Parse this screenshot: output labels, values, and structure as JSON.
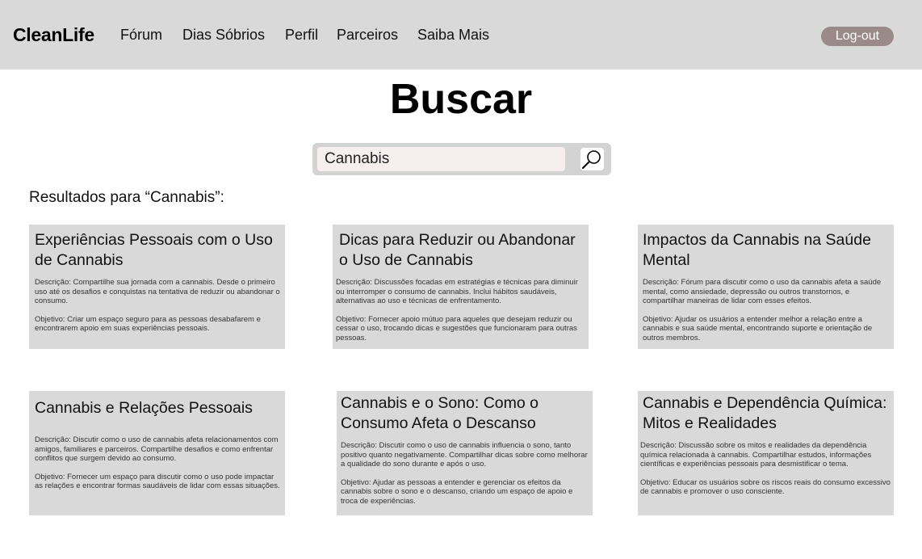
{
  "header": {
    "logo": "CleanLife",
    "nav": [
      {
        "label": "Fórum"
      },
      {
        "label": "Dias Sóbrios"
      },
      {
        "label": "Perfil"
      },
      {
        "label": "Parceiros"
      },
      {
        "label": "Saiba Mais"
      }
    ],
    "logout_label": "Log-out"
  },
  "page": {
    "title": "Buscar"
  },
  "search": {
    "value": "Cannabis",
    "icon": "search-icon"
  },
  "results": {
    "label": "Resultados para “Cannabis”:",
    "cards": [
      {
        "title": "Experiências Pessoais com o Uso de Cannabis",
        "description": "Descrição: Compartilhe sua jornada com a cannabis. Desde o primeiro uso até os desafios e conquistas na tentativa de reduzir ou abandonar o consumo.",
        "objective": "Objetivo: Criar um espaço seguro para as pessoas desabafarem e encontrarem apoio em suas experiências pessoais."
      },
      {
        "title": "Dicas para Reduzir ou Abandonar o Uso de Cannabis",
        "description": "Descrição: Discussões focadas em estratégias e técnicas para diminuir ou interromper o consumo de cannabis. Inclui hábitos saudáveis, alternativas ao uso e técnicas de enfrentamento.",
        "objective": "Objetivo: Fornecer apoio mútuo para aqueles que desejam reduzir ou cessar o uso, trocando dicas e sugestões que funcionaram para outras pessoas."
      },
      {
        "title": "Impactos da Cannabis na Saúde Mental",
        "description": "Descrição: Fórum para discutir como o uso da cannabis afeta a saúde mental, como ansiedade, depressão ou outros transtornos, e compartilhar maneiras de lidar com esses efeitos.",
        "objective": "Objetivo: Ajudar os usuários a entender melhor a relação entre a cannabis e sua saúde mental, encontrando suporte e orientação de outros membros."
      },
      {
        "title": "Cannabis e Relações Pessoais",
        "description": "Descrição: Discutir como o uso de cannabis afeta relacionamentos com amigos, familiares e parceiros. Compartilhe desafios e como enfrentar conflitos que surgem devido ao consumo.",
        "objective": "Objetivo: Fornecer um espaço para discutir como o uso pode impactar as relações e encontrar formas saudáveis de lidar com essas situações."
      },
      {
        "title": "Cannabis e o Sono: Como o Consumo Afeta o Descanso",
        "description": "Descrição: Discutir como o uso de cannabis influencia o sono, tanto positivo quanto negativamente. Compartilhar dicas sobre como melhorar a qualidade do sono durante e após o uso.",
        "objective": "Objetivo: Ajudar as pessoas a entender e gerenciar os efeitos da cannabis sobre o sono e o descanso, criando um espaço de apoio e troca de experiências."
      },
      {
        "title": "Cannabis e Dependência Química: Mitos e Realidades",
        "description": "Descrição: Discussão sobre os mitos e realidades da dependência química relacionada à cannabis. Compartilhar estudos, informações científicas e experiências pessoais para desmistificar o tema.",
        "objective": "Objetivo: Educar os usuários sobre os riscos reais do consumo excessivo de cannabis e promover o uso consciente."
      }
    ]
  }
}
